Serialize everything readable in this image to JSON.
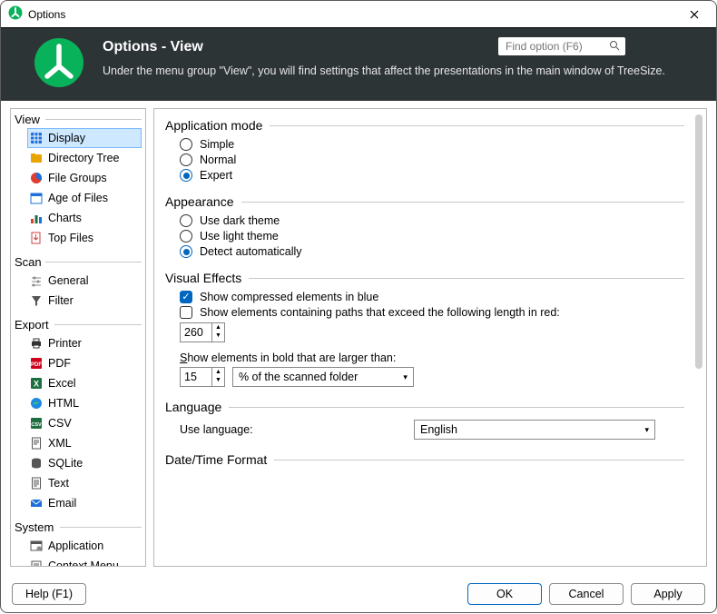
{
  "window": {
    "title": "Options"
  },
  "header": {
    "title": "Options - View",
    "subtitle": "Under the menu group \"View\", you will find settings that affect the presentations in the main window of TreeSize.",
    "search_placeholder": "Find option (F6)"
  },
  "tree": {
    "groups": [
      {
        "label": "View",
        "lw": 34,
        "items": [
          {
            "label": "Display",
            "icon": "grid-icon",
            "color": "#1e6fd9",
            "selected": true
          },
          {
            "label": "Directory Tree",
            "icon": "folder-tree-icon",
            "color": "#e9a400"
          },
          {
            "label": "File Groups",
            "icon": "pie-icon",
            "color": "#e43c2e"
          },
          {
            "label": "Age of Files",
            "icon": "calendar-icon",
            "color": "#1e6fd9"
          },
          {
            "label": "Charts",
            "icon": "bars-icon",
            "color": "#e43c2e"
          },
          {
            "label": "Top Files",
            "icon": "doc-arrow-icon",
            "color": "#d04040"
          }
        ]
      },
      {
        "label": "Scan",
        "lw": 34,
        "items": [
          {
            "label": "General",
            "icon": "sliders-icon",
            "color": "#888"
          },
          {
            "label": "Filter",
            "icon": "funnel-icon",
            "color": "#555"
          }
        ]
      },
      {
        "label": "Export",
        "lw": 44,
        "items": [
          {
            "label": "Printer",
            "icon": "printer-icon",
            "color": "#333"
          },
          {
            "label": "PDF",
            "icon": "pdf-icon",
            "color": "#d0021b"
          },
          {
            "label": "Excel",
            "icon": "excel-icon",
            "color": "#1d6f42"
          },
          {
            "label": "HTML",
            "icon": "edge-icon",
            "color": "#1e88e5"
          },
          {
            "label": "CSV",
            "icon": "csv-icon",
            "color": "#1d6f42"
          },
          {
            "label": "XML",
            "icon": "doc-icon",
            "color": "#555"
          },
          {
            "label": "SQLite",
            "icon": "db-icon",
            "color": "#555"
          },
          {
            "label": "Text",
            "icon": "doc-lines-icon",
            "color": "#555"
          },
          {
            "label": "Email",
            "icon": "mail-icon",
            "color": "#1e6fd9"
          }
        ]
      },
      {
        "label": "System",
        "lw": 50,
        "items": [
          {
            "label": "Application",
            "icon": "window-gear-icon",
            "color": "#555"
          },
          {
            "label": "Context Menu",
            "icon": "menu-icon",
            "color": "#555"
          }
        ]
      }
    ]
  },
  "sections": {
    "app_mode": {
      "title": "Application mode",
      "options": [
        {
          "label": "Simple",
          "on": false
        },
        {
          "label": "Normal",
          "on": false
        },
        {
          "label": "Expert",
          "on": true
        }
      ]
    },
    "appearance": {
      "title": "Appearance",
      "options": [
        {
          "label": "Use dark theme",
          "on": false
        },
        {
          "label": "Use light theme",
          "on": false
        },
        {
          "label": "Detect automatically",
          "on": true
        }
      ]
    },
    "visual": {
      "title": "Visual Effects",
      "show_compressed": {
        "label": "Show compressed elements in blue",
        "on": true
      },
      "show_exceed": {
        "label": "Show elements containing paths that exceed the following length in red:",
        "on": false
      },
      "exceed_value": "260",
      "bold_label_pre": "S",
      "bold_label_rest": "how elements in bold that are larger than:",
      "bold_value": "15",
      "bold_unit": "% of the scanned folder"
    },
    "language": {
      "title": "Language",
      "label": "Use language:",
      "value": "English"
    },
    "datetime": {
      "title": "Date/Time Format"
    }
  },
  "footer": {
    "help": "Help (F1)",
    "ok": "OK",
    "cancel": "Cancel",
    "apply": "Apply"
  }
}
